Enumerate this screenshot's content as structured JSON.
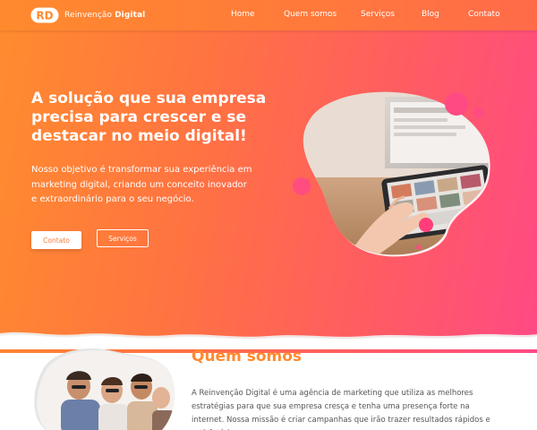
{
  "header": {
    "logo_letters": "RD",
    "logo_name_light": "Reinvenção",
    "logo_name_bold": "Digital",
    "nav": [
      {
        "label": "Home"
      },
      {
        "label": "Quem somos"
      },
      {
        "label": "Serviços"
      },
      {
        "label": "Blog"
      },
      {
        "label": "Contato"
      }
    ]
  },
  "hero": {
    "title": "A solução que sua empresa precisa para crescer e se destacar no meio digital!",
    "text": "Nosso objetivo é transformar sua experiência em marketing digital, criando um conceito inovador e extraordinário para o seu negócio.",
    "primary_button": "Contato",
    "secondary_button": "Serviços"
  },
  "about": {
    "title": "Quem somos",
    "text": "A Reinvenção Digital é uma agência de marketing que utiliza as melhores estratégias para que sua empresa cresça e tenha uma presença forte na internet. Nossa missão é criar campanhas que irão trazer resultados rápidos e satisfatórios."
  },
  "colors": {
    "orange": "#ff8a2e",
    "pink": "#ff4a84",
    "white": "#ffffff"
  }
}
